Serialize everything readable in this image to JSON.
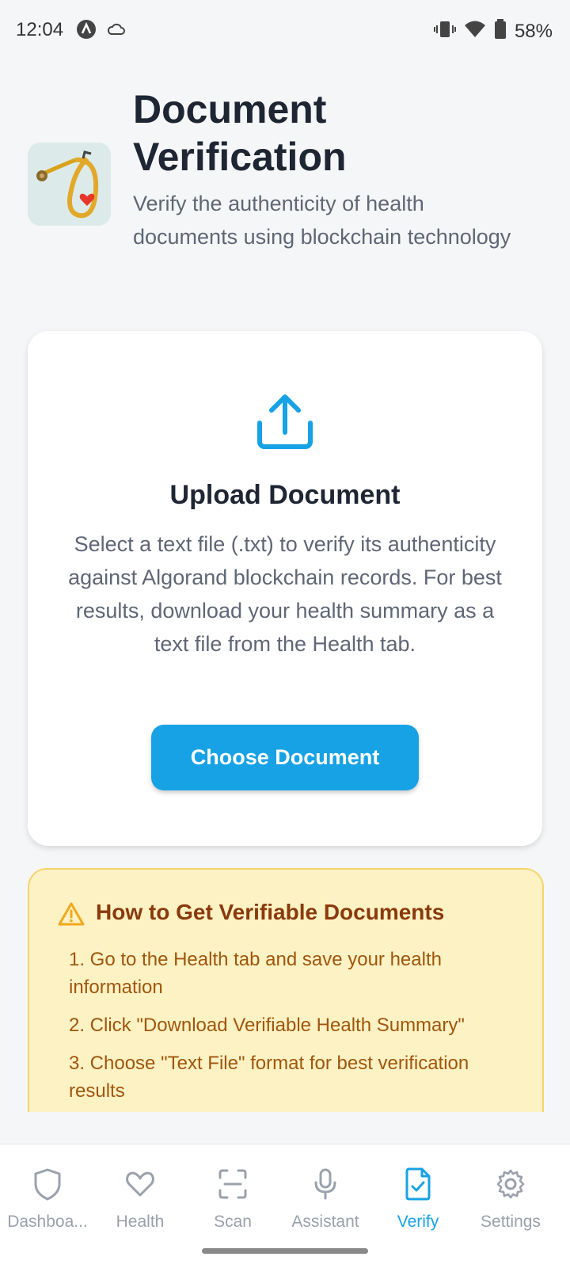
{
  "status_bar": {
    "time": "12:04",
    "battery_percent": "58%",
    "icons": [
      "notification-a-icon",
      "cloud-icon",
      "vibrate-icon",
      "wifi-icon",
      "battery-icon"
    ]
  },
  "header": {
    "title": "Document Verification",
    "subtitle": "Verify the authenticity of health documents using blockchain technology",
    "logo_icon": "stethoscope-heart-icon"
  },
  "upload_card": {
    "icon": "upload-icon",
    "title": "Upload Document",
    "description": "Select a text file (.txt) to verify its authenticity against Algorand blockchain records. For best results, download your health summary as a text file from the Health tab.",
    "button_label": "Choose Document"
  },
  "info_card": {
    "icon": "warning-icon",
    "title": "How to Get Verifiable Documents",
    "steps": [
      "1. Go to the Health tab and save your health information",
      "2. Click \"Download Verifiable Health Summary\"",
      "3. Choose \"Text File\" format for best verification results"
    ]
  },
  "bottom_nav": {
    "items": [
      {
        "label": "Dashboa...",
        "icon": "shield-icon"
      },
      {
        "label": "Health",
        "icon": "heart-icon"
      },
      {
        "label": "Scan",
        "icon": "scan-icon"
      },
      {
        "label": "Assistant",
        "icon": "microphone-icon"
      },
      {
        "label": "Verify",
        "icon": "document-check-icon"
      },
      {
        "label": "Settings",
        "icon": "gear-icon"
      }
    ],
    "active": "Verify"
  },
  "colors": {
    "accent": "#17A2E6",
    "info_background": "#FCF2C4",
    "info_title": "#8A3A0C",
    "info_text": "#A0560D",
    "warning_icon": "#F0A81E"
  }
}
